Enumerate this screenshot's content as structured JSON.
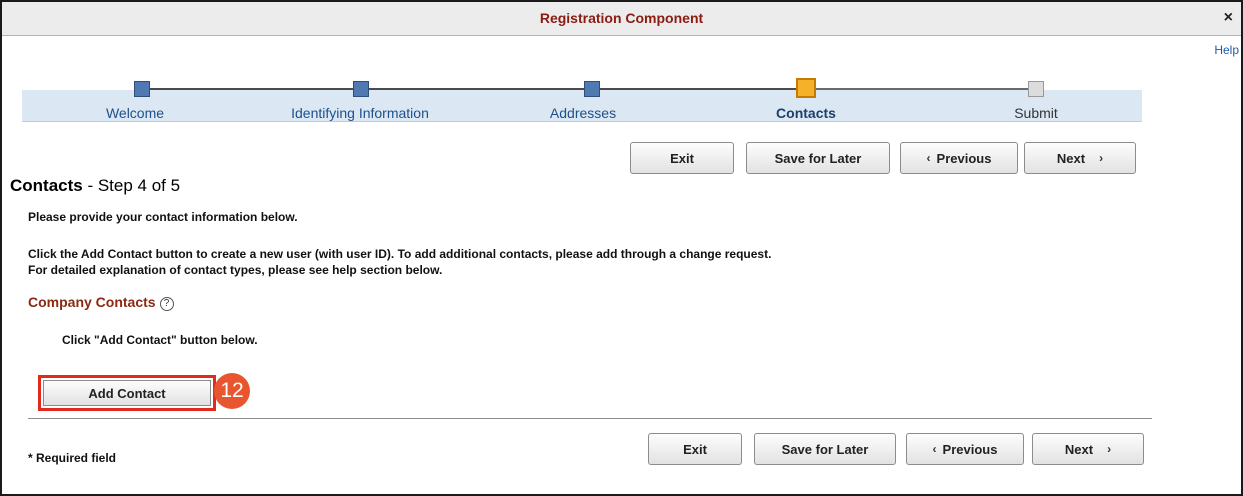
{
  "window": {
    "title": "Registration Component",
    "close_glyph": "×",
    "help_label": "Help"
  },
  "steps": [
    {
      "label": "Welcome",
      "state": "done"
    },
    {
      "label": "Identifying Information",
      "state": "done"
    },
    {
      "label": "Addresses",
      "state": "done"
    },
    {
      "label": "Contacts",
      "state": "current"
    },
    {
      "label": "Submit",
      "state": "todo"
    }
  ],
  "nav": {
    "exit_label": "Exit",
    "save_label": "Save for Later",
    "previous_label": "Previous",
    "next_label": "Next",
    "prev_chevron": "‹",
    "next_chevron": "›"
  },
  "page": {
    "title": "Contacts",
    "step_text": " - Step 4 of 5",
    "intro": "Please provide your contact information below.",
    "instruction_1": "Click the Add Contact button to create a new user (with user ID).  To add additional contacts, please add through a change request.",
    "instruction_2": "For detailed explanation of contact types, please see help section below."
  },
  "company_contacts": {
    "title": "Company Contacts",
    "help_glyph": "?",
    "hint": "Click \"Add Contact\" button below.",
    "add_label": "Add Contact",
    "callout_number": "12"
  },
  "footer": {
    "required_note": "* Required field"
  },
  "colors": {
    "title": "#8a1c12",
    "step_done": "#4e79b2",
    "step_current": "#f6b12a",
    "stepbar_bg": "#dbe8f4",
    "highlight_border": "#e12b1f",
    "callout": "#e8562f"
  }
}
